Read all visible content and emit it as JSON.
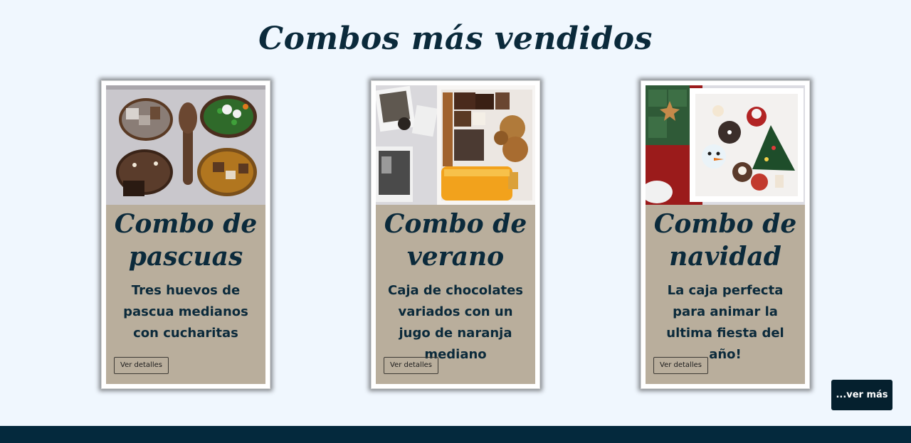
{
  "section": {
    "title": "Combos más vendidos"
  },
  "cards": [
    {
      "title_line1": "Combo de",
      "title_line2": "pascuas",
      "description": "Tres huevos de pascua medianos con cucharitas",
      "button_label": "Ver detalles",
      "photo_icon": "easter-eggs-photo"
    },
    {
      "title_line1": "Combo de",
      "title_line2": "verano",
      "description": "Caja de chocolates variados con un jugo de naranja mediano",
      "button_label": "Ver detalles",
      "photo_icon": "summer-box-photo"
    },
    {
      "title_line1": "Combo de",
      "title_line2": "navidad",
      "description": "La caja perfecta para animar la ultima fiesta del año!",
      "button_label": "Ver detalles",
      "photo_icon": "christmas-box-photo"
    }
  ],
  "more_button": {
    "label": "...ver más"
  },
  "colors": {
    "background": "#f0f7fe",
    "card_body": "#b9ae9c",
    "text_dark": "#0b2a3b",
    "footer": "#04293d",
    "more_button": "#05202e"
  }
}
